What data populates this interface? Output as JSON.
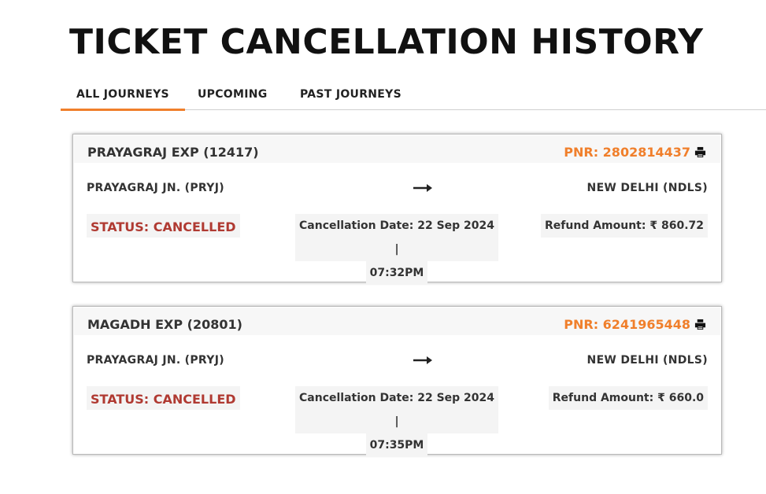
{
  "page": {
    "title": "TICKET CANCELLATION HISTORY"
  },
  "tabs": [
    {
      "label": "ALL JOURNEYS",
      "active": true
    },
    {
      "label": "UPCOMING",
      "active": false
    },
    {
      "label": "PAST JOURNEYS",
      "active": false
    }
  ],
  "colors": {
    "accent": "#f07f2b",
    "status_cancelled": "#b03a32"
  },
  "journeys": [
    {
      "train": "PRAYAGRAJ EXP (12417)",
      "pnr": "PNR: 2802814437",
      "from": "PRAYAGRAJ JN. (PRYJ)",
      "to": "NEW DELHI (NDLS)",
      "status": "STATUS: CANCELLED",
      "cancellation_date_line1": "Cancellation Date: 22 Sep 2024 |",
      "cancellation_date_line2": "07:32PM",
      "refund": "Refund Amount: ₹ 860.72",
      "print_icon": "printer-icon",
      "arrow_icon": "arrow-right-icon"
    },
    {
      "train": "MAGADH EXP (20801)",
      "pnr": "PNR: 6241965448",
      "from": "PRAYAGRAJ JN. (PRYJ)",
      "to": "NEW DELHI (NDLS)",
      "status": "STATUS: CANCELLED",
      "cancellation_date_line1": "Cancellation Date: 22 Sep 2024 |",
      "cancellation_date_line2": "07:35PM",
      "refund": "Refund Amount: ₹ 660.0",
      "print_icon": "printer-icon",
      "arrow_icon": "arrow-right-icon"
    }
  ]
}
